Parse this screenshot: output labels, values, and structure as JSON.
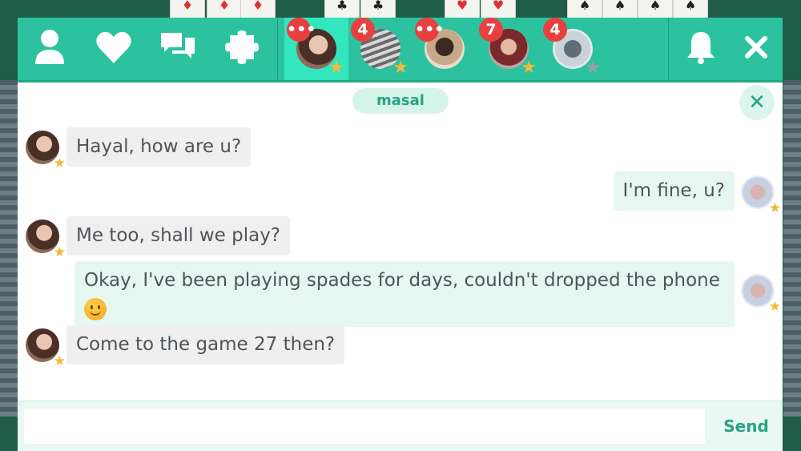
{
  "topbar": {
    "nav_icons": [
      "profile-icon",
      "heart-icon",
      "chat-bubbles-icon",
      "puzzle-icon"
    ],
    "friends": [
      {
        "badge": "•••",
        "star": "gold",
        "active": true
      },
      {
        "badge": "4",
        "star": "gold",
        "active": false
      },
      {
        "badge": "•••",
        "star": "none",
        "active": false
      },
      {
        "badge": "7",
        "star": "gold",
        "active": false
      },
      {
        "badge": "4",
        "star": "grey",
        "active": false
      }
    ],
    "right_icons": [
      "bell-icon",
      "close-icon"
    ],
    "accent": "#2cc29f"
  },
  "chat": {
    "partner_name": "masal",
    "messages": [
      {
        "from": "partner",
        "text": "Hayal, how are u?"
      },
      {
        "from": "me",
        "text": "I'm fine, u?"
      },
      {
        "from": "partner",
        "text": "Me too, shall we play?"
      },
      {
        "from": "me",
        "text": "Okay, I've been playing spades for days, couldn't dropped the phone",
        "emoji": "smiley"
      },
      {
        "from": "partner",
        "text": "Come to the game 27 then?"
      }
    ]
  },
  "composer": {
    "placeholder": "",
    "value": "",
    "send_label": "Send"
  }
}
